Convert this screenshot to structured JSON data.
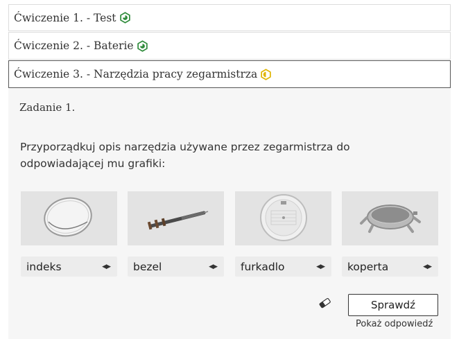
{
  "accordion": {
    "items": [
      {
        "label": "Ćwiczenie 1. - Test",
        "status": "completed",
        "status_icon": "hexagon-check-icon",
        "color": "#2e8b3a"
      },
      {
        "label": "Ćwiczenie 2. - Baterie",
        "status": "completed",
        "status_icon": "hexagon-check-icon",
        "color": "#2e8b3a"
      },
      {
        "label": "Ćwiczenie 3. - Narzędzia pracy zegarmistrza",
        "status": "in-progress",
        "status_icon": "hexagon-half-icon",
        "color": "#e0b400"
      }
    ]
  },
  "task": {
    "title": "Zadanie 1.",
    "instruction": "Przyporządkuj opis narzędzia używane przez zegarmistrza do odpowiadającej mu grafiki:",
    "images": [
      {
        "icon": "watch-glass-image"
      },
      {
        "icon": "screwdriver-image"
      },
      {
        "icon": "dial-image"
      },
      {
        "icon": "watch-case-image"
      }
    ],
    "selects": [
      {
        "value": "indeks"
      },
      {
        "value": "bezel"
      },
      {
        "value": "furkadlo"
      },
      {
        "value": "koperta"
      }
    ]
  },
  "actions": {
    "check_label": "Sprawdź",
    "show_answer_label": "Pokaż odpowiedź",
    "clear_icon": "eraser-icon"
  }
}
